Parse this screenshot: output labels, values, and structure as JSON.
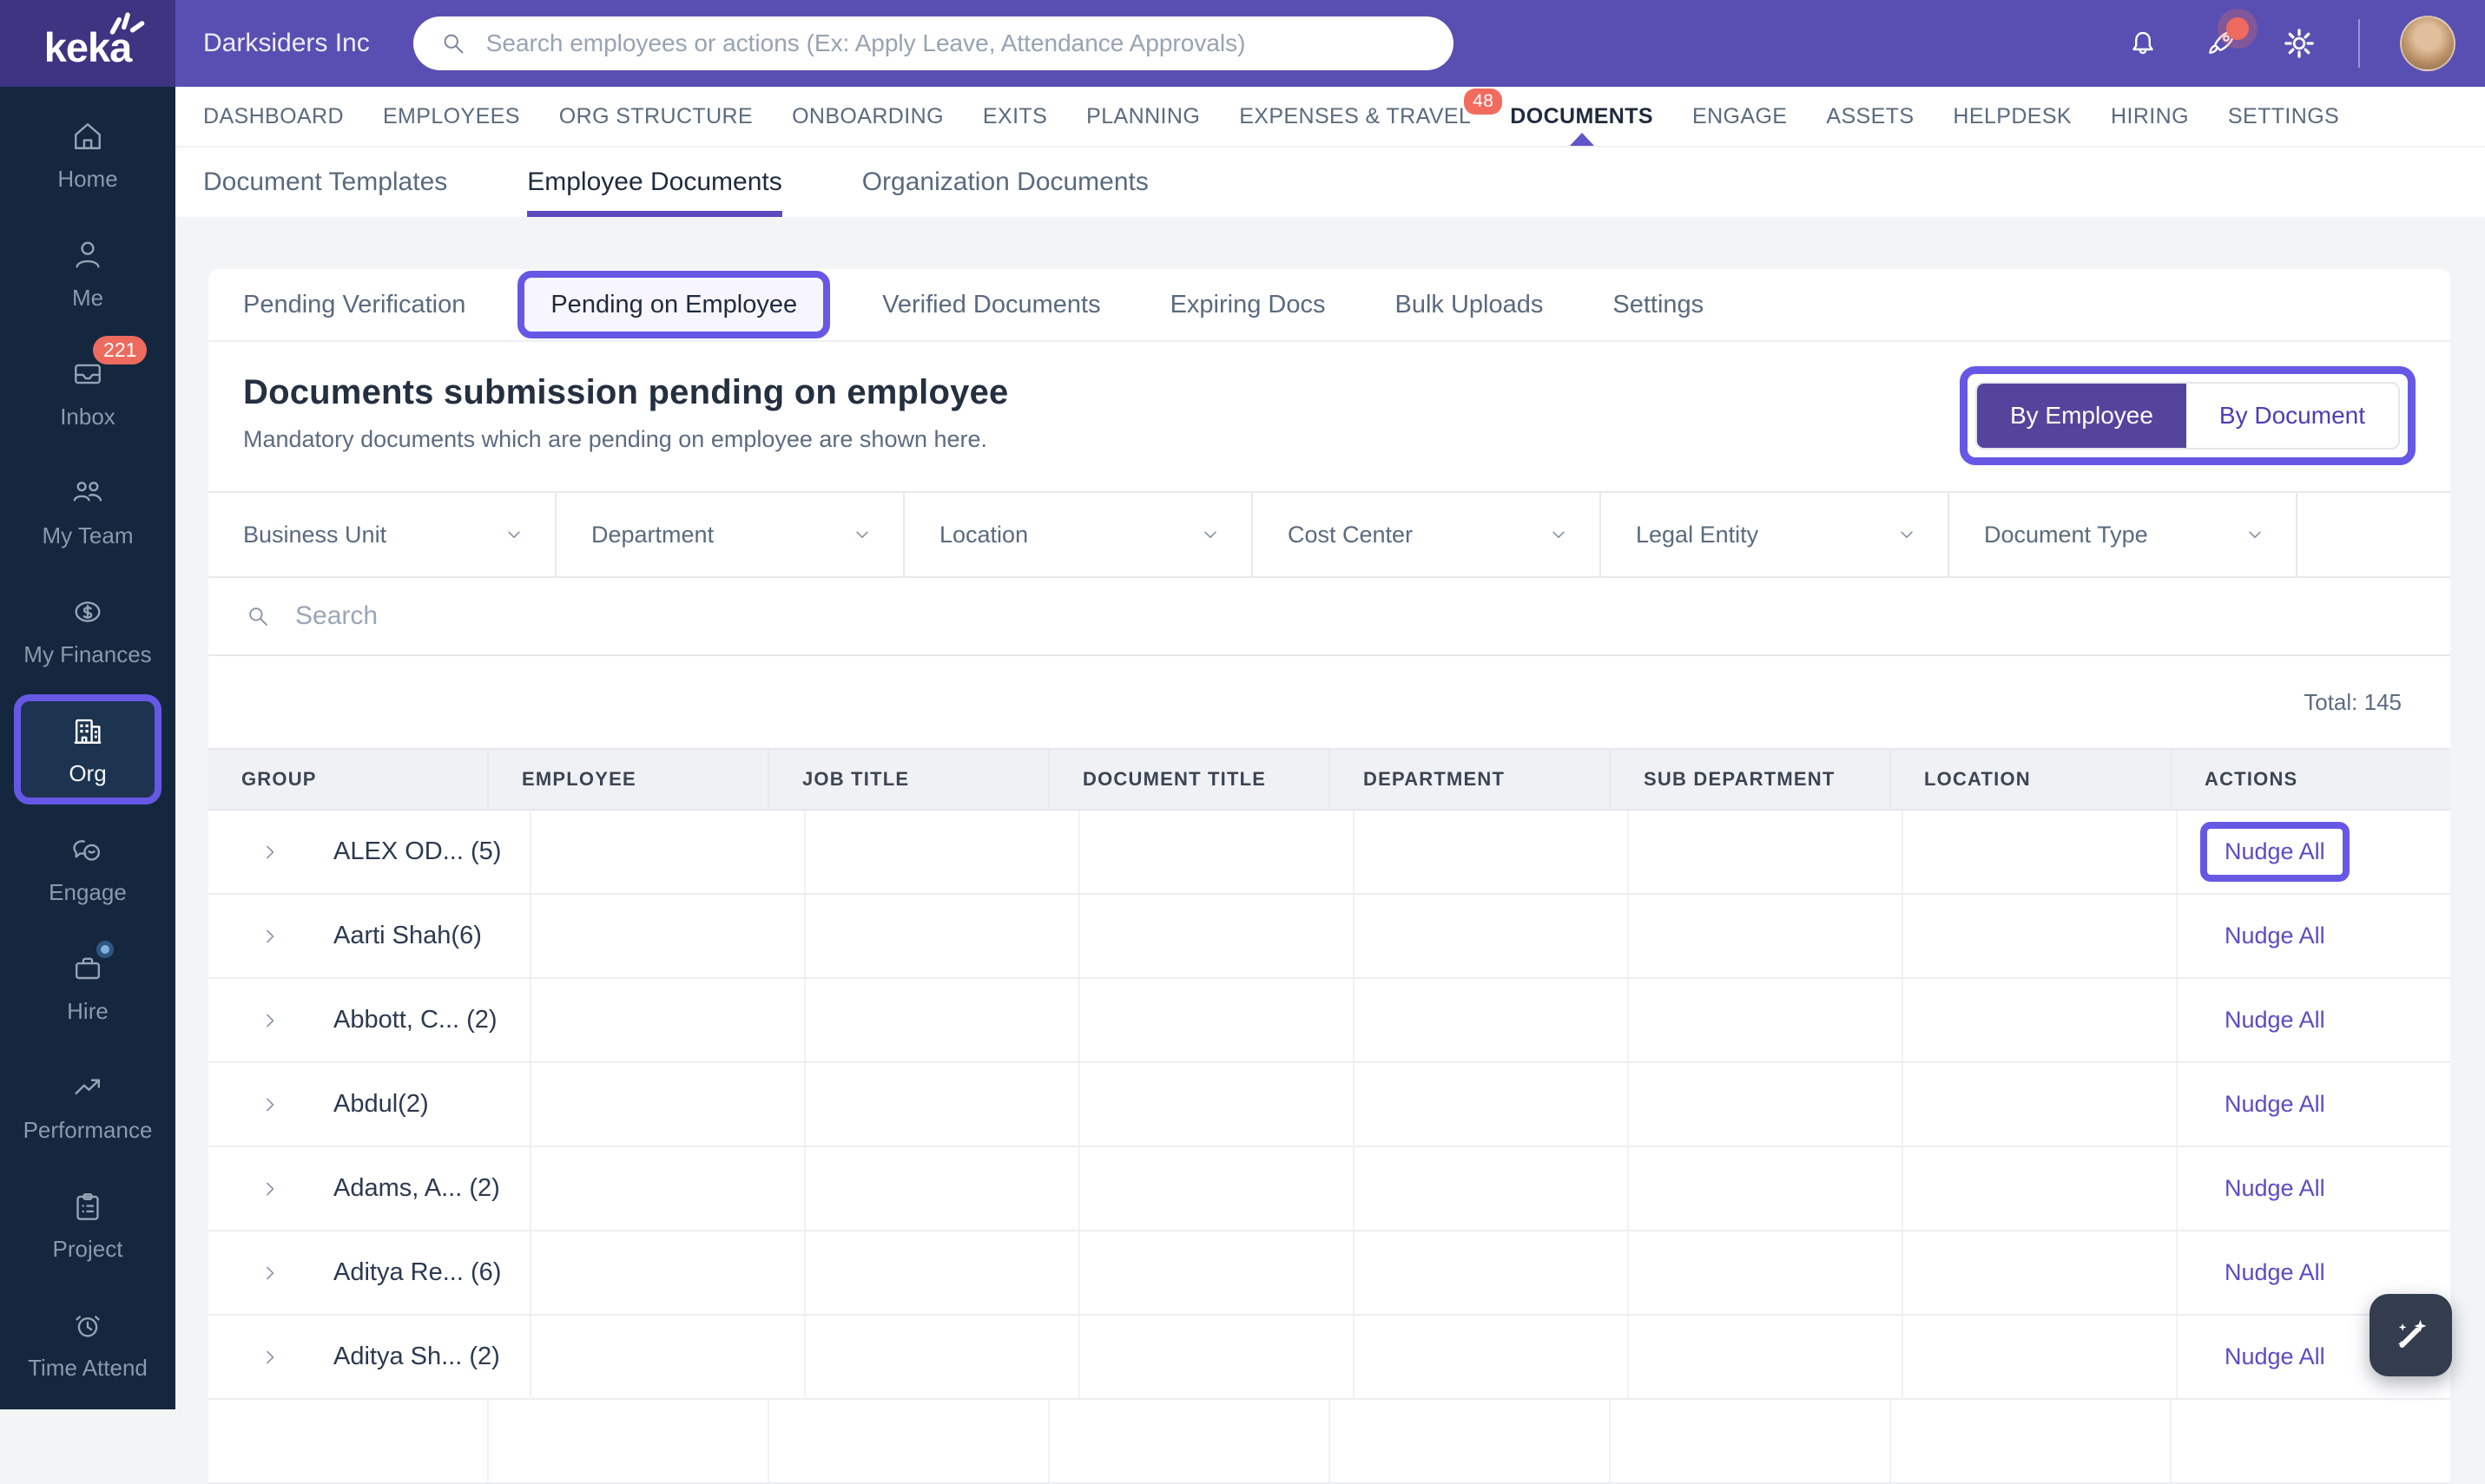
{
  "colors": {
    "topbar": "#594FB2",
    "logo_bg": "#3E3482",
    "sidebar_bg": "#14273E",
    "annotation": "#6658E5",
    "accent_underline": "#5F49BE",
    "badge_red": "#ED6A5E",
    "link": "#5B4BC6",
    "toggle_active_bg": "#54449C"
  },
  "topbar": {
    "logo_text": "keka",
    "company": "Darksiders Inc",
    "search_placeholder": "Search employees or actions (Ex: Apply Leave, Attendance Approvals)"
  },
  "main_nav": [
    {
      "label": "DASHBOARD"
    },
    {
      "label": "EMPLOYEES"
    },
    {
      "label": "ORG STRUCTURE"
    },
    {
      "label": "ONBOARDING"
    },
    {
      "label": "EXITS"
    },
    {
      "label": "PLANNING"
    },
    {
      "label": "EXPENSES & TRAVEL",
      "badge": "48"
    },
    {
      "label": "DOCUMENTS",
      "active": true
    },
    {
      "label": "ENGAGE"
    },
    {
      "label": "ASSETS"
    },
    {
      "label": "HELPDESK"
    },
    {
      "label": "HIRING"
    },
    {
      "label": "SETTINGS"
    }
  ],
  "subnav": [
    {
      "label": "Document Templates"
    },
    {
      "label": "Employee Documents",
      "active": true
    },
    {
      "label": "Organization Documents"
    }
  ],
  "sidebar": [
    {
      "label": "Home",
      "icon": "home-icon"
    },
    {
      "label": "Me",
      "icon": "person-icon"
    },
    {
      "label": "Inbox",
      "icon": "inbox-icon",
      "badge": "221"
    },
    {
      "label": "My Team",
      "icon": "team-icon"
    },
    {
      "label": "My Finances",
      "icon": "finances-icon"
    },
    {
      "label": "Org",
      "icon": "org-icon",
      "active": true,
      "annotated": true
    },
    {
      "label": "Engage",
      "icon": "engage-icon"
    },
    {
      "label": "Hire",
      "icon": "hire-icon",
      "dot": true
    },
    {
      "label": "Performance",
      "icon": "performance-icon"
    },
    {
      "label": "Project",
      "icon": "project-icon"
    },
    {
      "label": "Time Attend",
      "icon": "time-attend-icon"
    }
  ],
  "pill_tabs": [
    {
      "label": "Pending Verification"
    },
    {
      "label": "Pending on Employee",
      "active": true,
      "annotated": true
    },
    {
      "label": "Verified Documents"
    },
    {
      "label": "Expiring Docs"
    },
    {
      "label": "Bulk Uploads"
    },
    {
      "label": "Settings"
    }
  ],
  "page": {
    "title": "Documents submission pending on employee",
    "subtitle": "Mandatory documents which are pending on employee are shown here."
  },
  "view_toggle": {
    "options": [
      "By Employee",
      "By Document"
    ],
    "active": "By Employee",
    "annotated": true
  },
  "filters": [
    "Business Unit",
    "Department",
    "Location",
    "Cost Center",
    "Legal Entity",
    "Document Type"
  ],
  "list_search": {
    "placeholder": "Search"
  },
  "table": {
    "total_label": "Total: 145",
    "columns": [
      "GROUP",
      "EMPLOYEE",
      "JOB TITLE",
      "DOCUMENT TITLE",
      "DEPARTMENT",
      "SUB DEPARTMENT",
      "LOCATION",
      "ACTIONS"
    ],
    "rows": [
      {
        "group": "ALEX OD... (5)",
        "action": "Nudge All",
        "annotated": true
      },
      {
        "group": "Aarti Shah(6)",
        "action": "Nudge All"
      },
      {
        "group": "Abbott, C... (2)",
        "action": "Nudge All"
      },
      {
        "group": "Abdul(2)",
        "action": "Nudge All"
      },
      {
        "group": "Adams, A... (2)",
        "action": "Nudge All"
      },
      {
        "group": "Aditya Re... (6)",
        "action": "Nudge All"
      },
      {
        "group": "Aditya Sh... (2)",
        "action": "Nudge All"
      },
      {
        "group": "",
        "action": "",
        "partial": true
      }
    ]
  }
}
